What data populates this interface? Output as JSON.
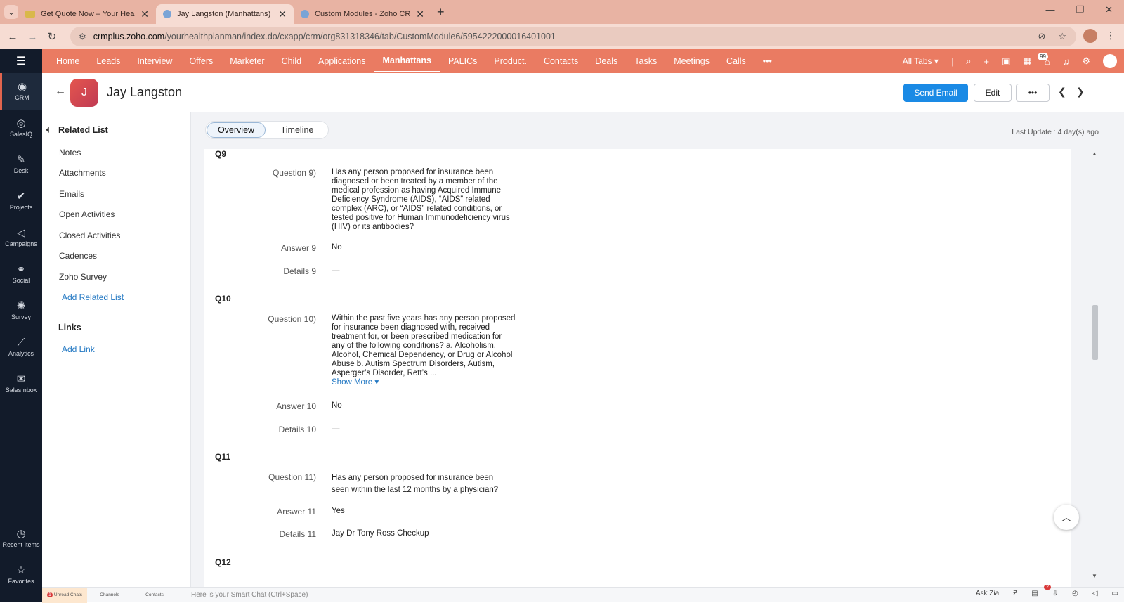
{
  "browser": {
    "tabs": [
      {
        "title": "Get Quote Now – Your Health P",
        "active": false
      },
      {
        "title": "Jay Langston (Manhattans) - Zo",
        "active": true
      },
      {
        "title": "Custom Modules - Zoho CRM",
        "active": false
      }
    ],
    "url_host": "crmplus.zoho.com",
    "url_path": "/yourhealthplanman/index.do/cxapp/crm/org831318346/tab/CustomModule6/5954222000016401001"
  },
  "rail": {
    "items": [
      {
        "label": "CRM",
        "icon": "crm-icon"
      },
      {
        "label": "SalesIQ",
        "icon": "salesiq-icon"
      },
      {
        "label": "Desk",
        "icon": "desk-icon"
      },
      {
        "label": "Projects",
        "icon": "projects-icon"
      },
      {
        "label": "Campaigns",
        "icon": "campaigns-icon"
      },
      {
        "label": "Social",
        "icon": "social-icon"
      },
      {
        "label": "Survey",
        "icon": "survey-icon"
      },
      {
        "label": "Analytics",
        "icon": "analytics-icon"
      },
      {
        "label": "SalesInbox",
        "icon": "salesinbox-icon"
      }
    ],
    "recent_items": "Recent Items",
    "favorites": "Favorites"
  },
  "appnav": {
    "modules": [
      "Home",
      "Leads",
      "Interview",
      "Offers",
      "Marketer",
      "Child",
      "Applications",
      "Manhattans",
      "PALICs",
      "Product.",
      "Contacts",
      "Deals",
      "Tasks",
      "Meetings",
      "Calls",
      "•••"
    ],
    "active": "Manhattans",
    "all_tabs": "All Tabs ▾",
    "notification_count": "99"
  },
  "record": {
    "initial": "J",
    "name": "Jay Langston",
    "send_email": "Send Email",
    "edit": "Edit",
    "more": "•••"
  },
  "related": {
    "title": "Related List",
    "items": [
      "Notes",
      "Attachments",
      "Emails",
      "Open Activities",
      "Closed Activities",
      "Cadences",
      "Zoho Survey"
    ],
    "add_related": "Add Related List",
    "links_title": "Links",
    "add_link": "Add Link"
  },
  "main": {
    "tab_overview": "Overview",
    "tab_timeline": "Timeline",
    "last_update": "Last Update : 4 day(s) ago"
  },
  "sections": {
    "q9": {
      "title": "Q9",
      "question_label": "Question 9)",
      "question": "Has any person proposed for insurance been diagnosed or been treated by a member of the medical profession as having Acquired Immune Deficiency Syndrome (AIDS), “AIDS” related complex (ARC), or “AIDS” related conditions, or tested positive for Human Immunodeficiency virus (HIV) or its antibodies?",
      "answer_label": "Answer 9",
      "answer": "No",
      "details_label": "Details 9",
      "details": "—"
    },
    "q10": {
      "title": "Q10",
      "question_label": "Question 10)",
      "question": "Within the past five years has any person proposed for insurance been diagnosed with, received treatment for, or been prescribed medication for any of the following conditions? a. Alcoholism, Alcohol, Chemical Dependency, or Drug or Alcohol Abuse b. Autism Spectrum Disorders, Autism, Asperger’s Disorder, Rett’s ...",
      "show_more": "Show More ▾",
      "answer_label": "Answer 10",
      "answer": "No",
      "details_label": "Details 10",
      "details": "—"
    },
    "q11": {
      "title": "Q11",
      "question_label": "Question 11)",
      "question": "Has any person proposed for insurance been seen within the last 12 months by a physician?",
      "answer_label": "Answer 11",
      "answer": "Yes",
      "details_label": "Details 11",
      "details": "Jay Dr Tony Ross Checkup"
    },
    "q12": {
      "title": "Q12"
    }
  },
  "bottombar": {
    "unread_chats": "Unread Chats",
    "unread_count": "1",
    "channels": "Channels",
    "contacts": "Contacts",
    "smart_chat_placeholder": "Here is your Smart Chat (Ctrl+Space)",
    "ask_zia": "Ask Zia",
    "download_count": "2"
  }
}
